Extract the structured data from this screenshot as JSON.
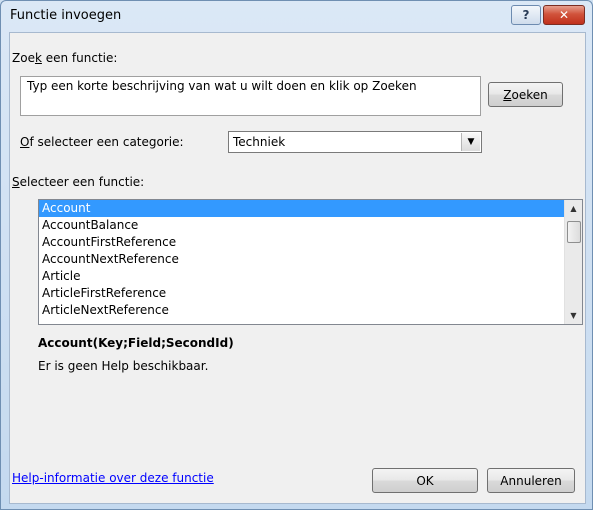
{
  "window": {
    "title": "Functie invoegen",
    "help_glyph": "?",
    "close_glyph": "✕"
  },
  "search": {
    "label": "Zoek een functie:",
    "description": "Typ een korte beschrijving van wat u wilt doen en klik op Zoeken",
    "button": "Zoeken"
  },
  "category": {
    "label": "Of selecteer een categorie:",
    "value": "Techniek"
  },
  "functions": {
    "label": "Selecteer een functie:",
    "items": [
      "Account",
      "AccountBalance",
      "AccountFirstReference",
      "AccountNextReference",
      "Article",
      "ArticleFirstReference",
      "ArticleNextReference"
    ],
    "selected": "Account"
  },
  "details": {
    "signature": "Account(Key;Field;SecondId)",
    "help_text": "Er is geen Help beschikbaar."
  },
  "footer": {
    "help_link": "Help-informatie over deze functie",
    "ok": "OK",
    "cancel": "Annuleren"
  },
  "colors": {
    "selection": "#3399ff",
    "link": "#0000ff"
  }
}
